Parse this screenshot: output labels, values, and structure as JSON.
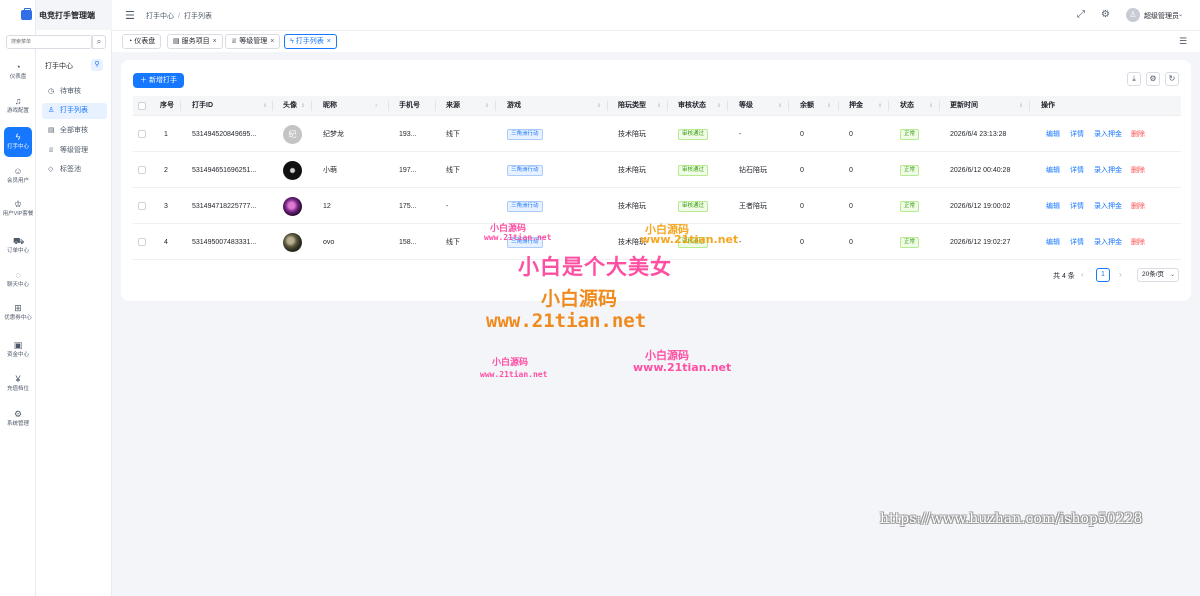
{
  "app": {
    "title": "电竞打手管理端"
  },
  "rail": {
    "items": [
      {
        "label": "仪表盘",
        "icon": "dashboard-icon"
      },
      {
        "label": "游戏配置",
        "icon": "bell-icon"
      },
      {
        "label": "打手中心",
        "icon": "lightning-icon",
        "active": true
      },
      {
        "label": "会员用户",
        "icon": "users-icon"
      },
      {
        "label": "用户VIP套餐",
        "icon": "crown-icon"
      },
      {
        "label": "订单中心",
        "icon": "cart-icon"
      },
      {
        "label": "聊天中心",
        "icon": "chat-icon"
      },
      {
        "label": "优惠券中心",
        "icon": "gift-icon"
      },
      {
        "label": "资金中心",
        "icon": "wallet-icon"
      },
      {
        "label": "充值档位",
        "icon": "yen-icon"
      },
      {
        "label": "系统管理",
        "icon": "gear-icon"
      }
    ]
  },
  "search": {
    "placeholder": "搜索菜单"
  },
  "submenu": {
    "title": "打手中心",
    "items": [
      {
        "label": "待审核",
        "icon": "clock-icon"
      },
      {
        "label": "打手列表",
        "icon": "user-icon",
        "active": true
      },
      {
        "label": "全部审核",
        "icon": "document-icon"
      },
      {
        "label": "等级管理",
        "icon": "trophy-icon"
      },
      {
        "label": "标签池",
        "icon": "tag-icon"
      }
    ]
  },
  "header": {
    "breadcrumb": [
      "打手中心",
      "打手列表"
    ],
    "user_name": "超级管理员"
  },
  "tabs": [
    {
      "label": "仪表盘",
      "icon": "dashboard-icon",
      "closable": false
    },
    {
      "label": "服务项目",
      "icon": "list-icon",
      "closable": true
    },
    {
      "label": "等级管理",
      "icon": "trophy-icon",
      "closable": true
    },
    {
      "label": "打手列表",
      "icon": "lightning-icon",
      "closable": true,
      "active": true
    }
  ],
  "toolbar": {
    "add_label": "新增打手"
  },
  "table": {
    "columns": [
      "序号",
      "打手ID",
      "头像",
      "昵称",
      "手机号",
      "来源",
      "游戏",
      "陪玩类型",
      "审核状态",
      "等级",
      "余额",
      "押金",
      "状态",
      "更新时间",
      "操作"
    ],
    "rows": [
      {
        "index": "1",
        "id": "531494520849695...",
        "avatar_text": "纪",
        "nickname": "纪梦龙",
        "phone": "193...",
        "source": "线下",
        "game": "三角洲行动",
        "play_type": "技术陪玩",
        "audit": "审核通过",
        "level": "-",
        "balance": "0",
        "deposit": "0",
        "status": "正常",
        "updated": "2026/6/4 23:13:28"
      },
      {
        "index": "2",
        "id": "531494651696251...",
        "avatar_text": "",
        "nickname": "小萌",
        "phone": "197...",
        "source": "线下",
        "game": "三角洲行动",
        "play_type": "技术陪玩",
        "audit": "审核通过",
        "level": "钻石陪玩",
        "balance": "0",
        "deposit": "0",
        "status": "正常",
        "updated": "2026/6/12 00:40:28"
      },
      {
        "index": "3",
        "id": "531494718225777...",
        "avatar_text": "",
        "nickname": "12",
        "phone": "175...",
        "source": "-",
        "game": "三角洲行动",
        "play_type": "技术陪玩",
        "audit": "审核通过",
        "level": "王者陪玩",
        "balance": "0",
        "deposit": "0",
        "status": "正常",
        "updated": "2026/6/12 19:00:02"
      },
      {
        "index": "4",
        "id": "531495007483331...",
        "avatar_text": "",
        "nickname": "ovo",
        "phone": "158...",
        "source": "线下",
        "game": "三角洲行动",
        "play_type": "技术陪玩",
        "audit": "审核通过",
        "level": "-",
        "balance": "0",
        "deposit": "0",
        "status": "正常",
        "updated": "2026/6/12 19:02:27"
      }
    ],
    "actions": [
      "编辑",
      "详情",
      "录入押金",
      "删除"
    ]
  },
  "pagination": {
    "total_text": "共 4 条",
    "current_page": "1",
    "page_size": "20条/页"
  },
  "watermarks": {
    "big_pink": "小白是个大美女",
    "brand_orange": "小白源码",
    "url_orange": "www.21tian.net",
    "small_brand": "小白源码",
    "small_url": "www.21tian.net",
    "huzhan": "https://www.huzhan.com/ishop50228"
  },
  "colors": {
    "primary": "#1677ff",
    "danger": "#ff4d4f",
    "success": "#389e0d",
    "page_bg": "#f3f5f9"
  }
}
